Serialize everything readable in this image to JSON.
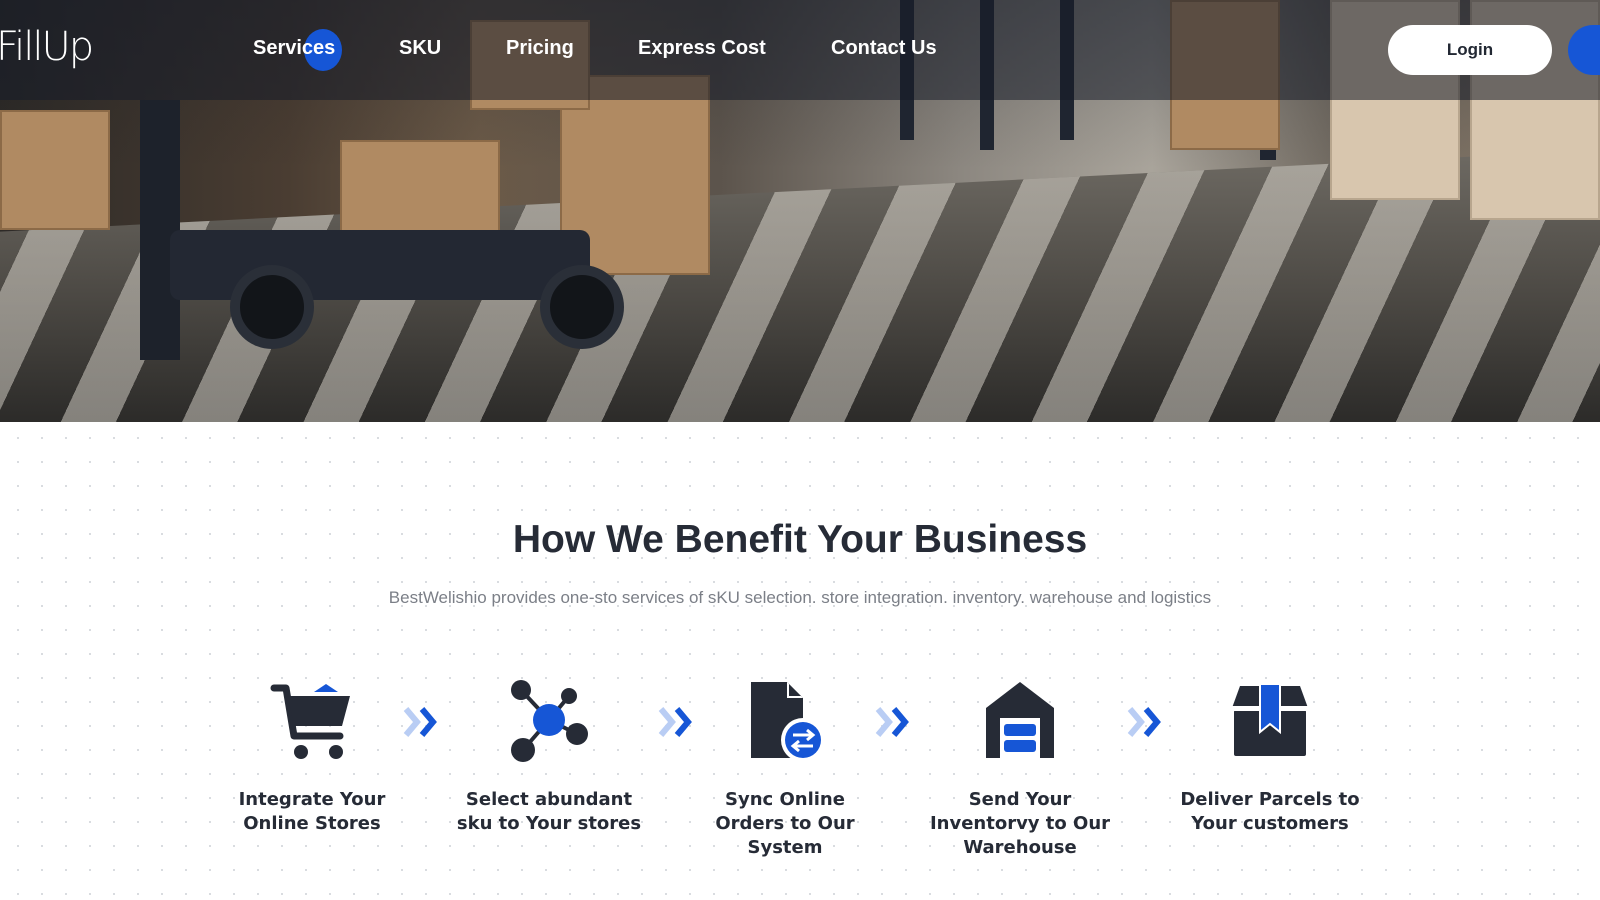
{
  "brand": {
    "logo_text": "FillUp"
  },
  "nav": {
    "items": [
      {
        "label": "Services",
        "active": true
      },
      {
        "label": "SKU"
      },
      {
        "label": "Pricing"
      },
      {
        "label": "Express Cost"
      },
      {
        "label": "Contact Us"
      }
    ],
    "login_label": "Login"
  },
  "colors": {
    "accent": "#1656d6",
    "accent_light": "#b9cdf4",
    "dark": "#262b36",
    "muted_text": "#7b7f87"
  },
  "hero": {
    "image": "warehouse-forklift-photo"
  },
  "benefits": {
    "title": "How We Benefit Your Business",
    "subtitle": "BestWelishio provides one-sto services of sKU selection. store integration. inventory. warehouse and logistics",
    "steps": [
      {
        "icon": "shopping-cart-icon",
        "label_line1": "Integrate Your",
        "label_line2": "Online Stores",
        "label_line3": ""
      },
      {
        "icon": "network-nodes-icon",
        "label_line1": "Select abundant",
        "label_line2": "sku to Your stores",
        "label_line3": ""
      },
      {
        "icon": "document-sync-icon",
        "label_line1": "Sync Online",
        "label_line2": "Orders to Our",
        "label_line3": "System"
      },
      {
        "icon": "warehouse-icon",
        "label_line1": "Send Your",
        "label_line2": "Inventorvy to Our",
        "label_line3": "Warehouse"
      },
      {
        "icon": "parcel-box-icon",
        "label_line1": "Deliver Parcels to",
        "label_line2": "Your customers",
        "label_line3": ""
      }
    ]
  }
}
